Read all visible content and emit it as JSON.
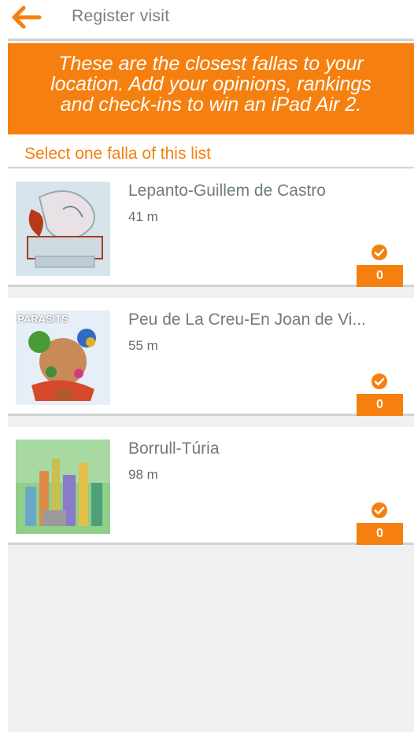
{
  "header": {
    "title": "Register visit",
    "back_icon": "arrow-left-icon"
  },
  "banner": {
    "lines": [
      "These are the closest fallas to your",
      "location. Add your opinions, rankings",
      "and check-ins to win an iPad Air 2."
    ]
  },
  "list": {
    "header": "Select one falla of this list",
    "items": [
      {
        "name": "Lepanto-Guillem de Castro",
        "distance": "41 m",
        "checkins": "0",
        "check_icon": "check-circle-icon"
      },
      {
        "name": "Peu de La Creu-En Joan de Vi...",
        "distance": "55 m",
        "checkins": "0",
        "check_icon": "check-circle-icon",
        "thumb_label": "PARASITS"
      },
      {
        "name": "Borrull-Túria",
        "distance": "98 m",
        "checkins": "0",
        "check_icon": "check-circle-icon"
      }
    ]
  },
  "colors": {
    "accent": "#f5800f",
    "background": "#eef0f1",
    "divider": "#cfd3d4",
    "title_text": "#7d7d7d"
  }
}
